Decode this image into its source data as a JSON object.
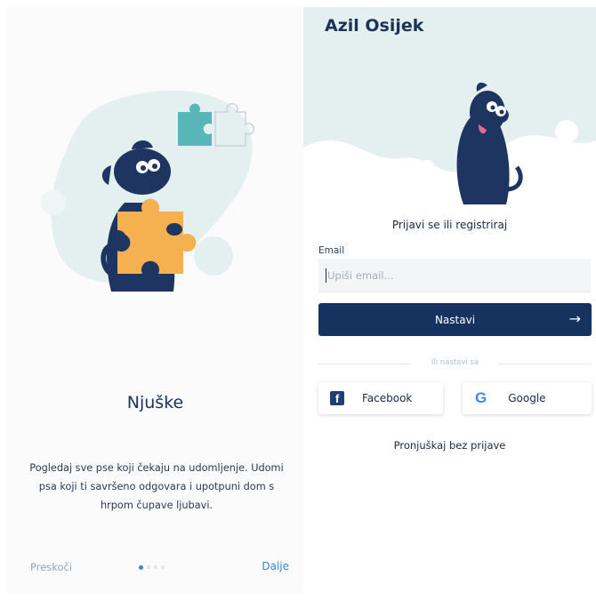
{
  "onboarding": {
    "title": "Njuške",
    "description": "Pogledaj sve pse koji čekaju na udomljenje. Udomi psa koji ti savršeno odgovara i upotpuni dom s hrpom čupave ljubavi.",
    "skip_label": "Preskoči",
    "next_label": "Dalje",
    "pagination": {
      "total": 4,
      "active": 1
    }
  },
  "login": {
    "app_title": "Azil Osijek",
    "heading": "Prijavi se ili registriraj",
    "email_label": "Email",
    "email_placeholder": "Upiši email...",
    "email_value": "",
    "continue_label": "Nastavi",
    "divider_text": "Ili nastavi sa",
    "facebook_label": "Facebook",
    "google_label": "Google",
    "guest_label": "Pronjuškaj bez prijave"
  },
  "icons": {
    "facebook": "facebook-icon",
    "google": "google-icon",
    "arrow": "arrow-right-icon"
  },
  "colors": {
    "primary": "#163360",
    "accent": "#3c86c9",
    "puzzle_orange": "#f5b04f",
    "puzzle_teal": "#58b5b8",
    "mint_bg": "#e4f0ef"
  }
}
